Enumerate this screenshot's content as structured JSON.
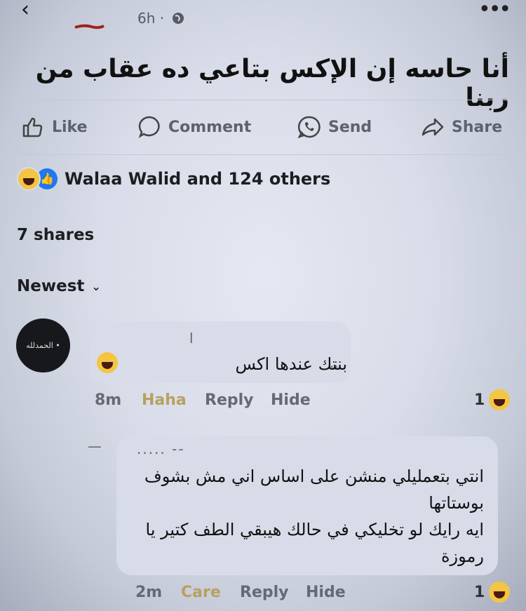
{
  "header": {
    "time": "6h ·"
  },
  "post": {
    "text": "أنا حاسه إن الإكس بتاعي ده عقاب من ربنا"
  },
  "actions": {
    "like": "Like",
    "comment": "Comment",
    "send": "Send",
    "share": "Share"
  },
  "reactions": {
    "label": "Walaa Walid and 124 others"
  },
  "shares": "7 shares",
  "sort": "Newest",
  "comments": [
    {
      "avatar_text": "الحمدلله •",
      "text": "بنتك عندها اكس",
      "time": "8m",
      "reaction": "Haha",
      "reply": "Reply",
      "hide": "Hide",
      "count": "1"
    },
    {
      "text_lines": [
        "انتي بتعمليلي منشن على اساس اني مش بشوف",
        "بوستاتها",
        "ايه رايك لو تخليكي في حالك هيبقي الطف كتير يا",
        "رموزة"
      ],
      "time": "2m",
      "reaction": "Care",
      "reply": "Reply",
      "hide": "Hide",
      "count": "1"
    }
  ],
  "colors": {
    "background": "#d9dde9",
    "text": "#1c1e21",
    "muted": "#656a73",
    "like_blue": "#1f77f2",
    "haha_yellow": "#f4c542"
  }
}
